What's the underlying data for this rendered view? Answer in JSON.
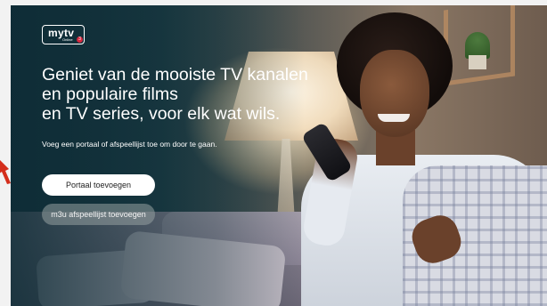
{
  "brand": {
    "logo_word": "mytv",
    "logo_sub": "Online",
    "logo_badge": "3"
  },
  "hero": {
    "headline_line1": "Geniet van de mooiste TV kanalen",
    "headline_line2": "en populaire films",
    "headline_line3": "en TV series, voor elk wat wils.",
    "subtext": "Voeg een portaal of afspeellijst toe om door te gaan."
  },
  "actions": {
    "add_portal": "Portaal toevoegen",
    "add_m3u": "m3u afspeellijst toevoegen"
  },
  "colors": {
    "badge": "#d7263d",
    "primary_button_bg": "#ffffff",
    "secondary_button_bg": "#96a0a0",
    "edge_arrow": "#d42e1c"
  },
  "icons": {
    "edge_arrow": "red-arrow-icon"
  }
}
